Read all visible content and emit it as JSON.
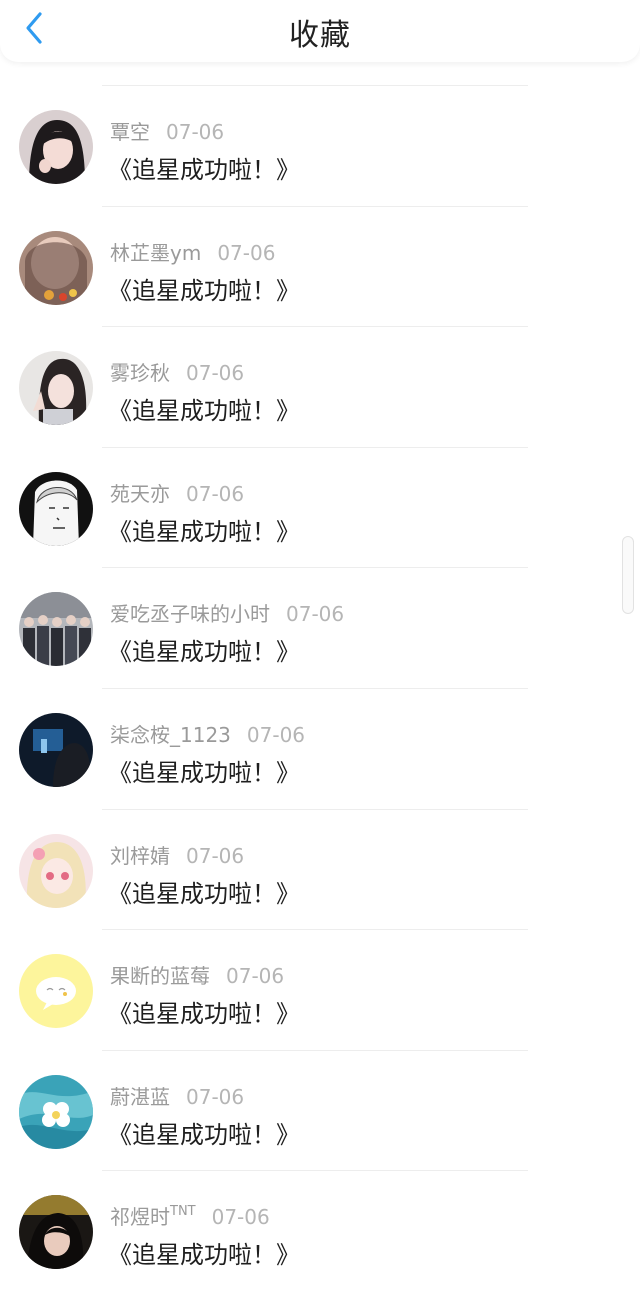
{
  "header": {
    "title": "收藏",
    "back_icon": "chevron-left-icon",
    "back_color": "#2f9bf0"
  },
  "items": [
    {
      "name": "覃空",
      "sup": "",
      "date": "07-06",
      "content": "《追星成功啦！》"
    },
    {
      "name": "林芷墨ym",
      "sup": "",
      "date": "07-06",
      "content": "《追星成功啦！》"
    },
    {
      "name": "雾珍秋",
      "sup": "",
      "date": "07-06",
      "content": "《追星成功啦！》"
    },
    {
      "name": "苑天亦",
      "sup": "",
      "date": "07-06",
      "content": "《追星成功啦！》"
    },
    {
      "name": "爱吃丞子味的小时",
      "sup": "",
      "date": "07-06",
      "content": "《追星成功啦！》"
    },
    {
      "name": "柒念桉_1123",
      "sup": "",
      "date": "07-06",
      "content": "《追星成功啦！》"
    },
    {
      "name": "刘梓婧",
      "sup": "",
      "date": "07-06",
      "content": "《追星成功啦！》"
    },
    {
      "name": "果断的蓝莓",
      "sup": "",
      "date": "07-06",
      "content": "《追星成功啦！》"
    },
    {
      "name": "蔚湛蓝",
      "sup": "",
      "date": "07-06",
      "content": "《追星成功啦！》"
    },
    {
      "name": "祁煜时",
      "sup": "TNT",
      "date": "07-06",
      "content": "《追星成功啦！》"
    }
  ]
}
